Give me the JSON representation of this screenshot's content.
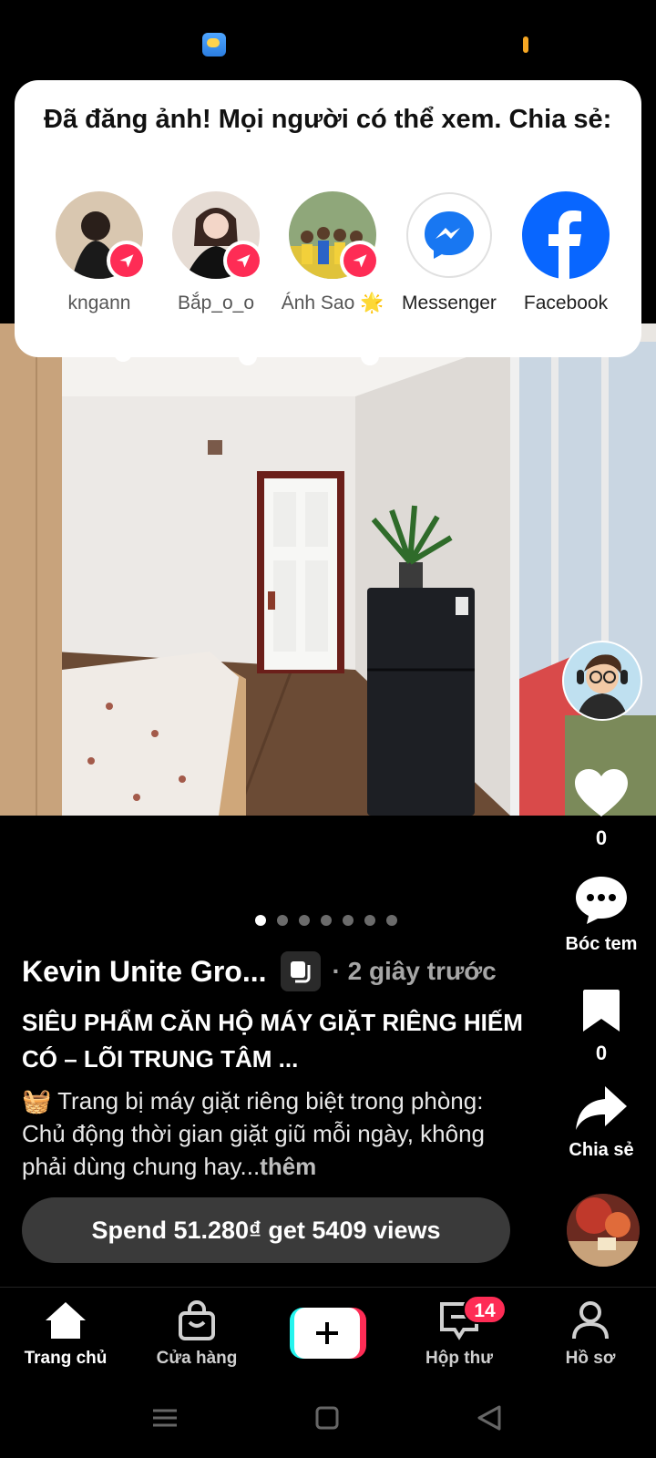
{
  "share_sheet": {
    "title": "Đã đăng ảnh! Mọi người có thể xem. Chia sẻ:",
    "targets": [
      {
        "label": "kngann"
      },
      {
        "label": "Bắp_o_o"
      },
      {
        "label": "Ánh Sao 🌟"
      },
      {
        "label": "Messenger"
      },
      {
        "label": "Facebook"
      }
    ]
  },
  "actions": {
    "like_count": "0",
    "comment_label": "Bóc tem",
    "save_count": "0",
    "share_label": "Chia sẻ"
  },
  "post": {
    "author": "Kevin Unite Gro...",
    "time": "· 2 giây trước",
    "title": "SIÊU PHẨM CĂN HỘ MÁY GIẶT RIÊNG HIẾM CÓ – LÕI TRUNG TÂM ...",
    "description": "🧺 Trang bị máy giặt riêng biệt trong phòng: Chủ động thời gian giặt giũ mỗi ngày, không phải dùng chung hay...",
    "more": "thêm",
    "photo_index": 1,
    "photo_count": 7
  },
  "promote": {
    "label": "Spend 51.280₫ get 5409 views"
  },
  "nav": {
    "home": "Trang chủ",
    "shop": "Cửa hàng",
    "inbox": "Hộp thư",
    "inbox_badge": "14",
    "profile": "Hồ sơ"
  },
  "colors": {
    "accent": "#fe2c55",
    "cyan": "#25f4ee",
    "messenger": "#1877f2",
    "facebook": "#0866ff"
  }
}
